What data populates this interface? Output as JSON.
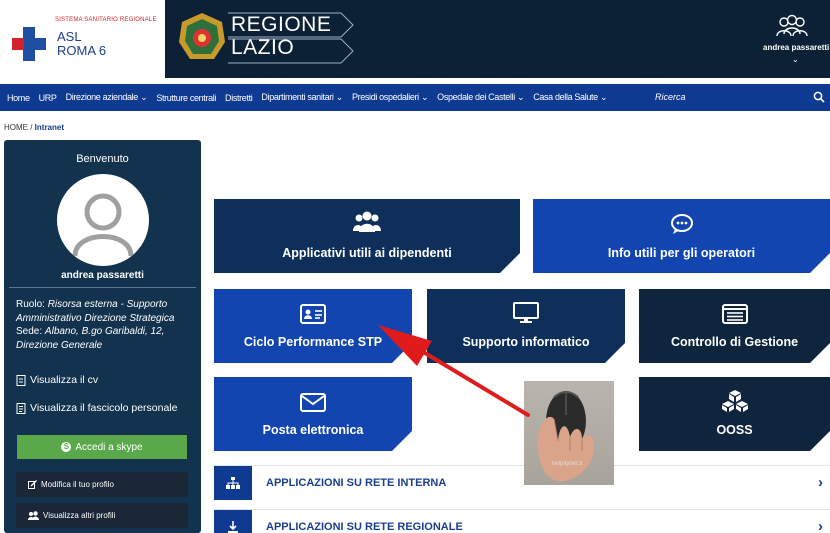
{
  "header": {
    "asl_supertitle": "SISTEMA SANITARIO REGIONALE",
    "asl_line1": "ASL",
    "asl_line2": "ROMA 6",
    "region_line1": "REGIONE",
    "region_line2": "LAZIO",
    "user_name": "andrea passaretti",
    "user_chevron": "⌄"
  },
  "nav": {
    "items": [
      "Home",
      "URP",
      "Direzione aziendale ⌄",
      "Strutture centrali",
      "Distretti",
      "Dipartimenti sanitari ⌄",
      "Presidi ospedalieri ⌄",
      "Ospedale dei Castelli ⌄",
      "Casa della Salute ⌄"
    ],
    "search_placeholder": "Ricerca"
  },
  "breadcrumb": {
    "home": "HOME",
    "sep": " / ",
    "current": "Intranet"
  },
  "sidebar": {
    "welcome": "Benvenuto",
    "name": "andrea passaretti",
    "role_label": "Ruolo: ",
    "role_value": "Risorsa esterna - Supporto Amministrativo Direzione Strategica",
    "seat_label": "Sede: ",
    "seat_value": "Albano, B.go Garibaldi, 12, Direzione Generale",
    "cv_link": "Visualizza il cv",
    "fascicolo_link": "Visualizza il fascicolo personale",
    "skype_button": "Accedi a skype",
    "edit_profile": "Modifica il tuo profilo",
    "other_profiles": "Visualizza altri profili"
  },
  "tiles": {
    "applicativi": "Applicativi utili ai dipendenti",
    "info": "Info utili per gli operatori",
    "ciclo": "Ciclo Performance STP",
    "supporto": "Supporto informatico",
    "controllo": "Controllo di Gestione",
    "posta": "Posta elettronica",
    "ooss": "OOSS"
  },
  "rows": {
    "interna": "APPLICAZIONI SU RETE INTERNA",
    "regionale": "APPLICAZIONI SU RETE REGIONALE",
    "chevron": "›"
  },
  "watermark": "helpitynet.it",
  "colors": {
    "nav_blue": "#0f3a92",
    "tile_bright": "#1245b0",
    "tile_dark": "#0f253d",
    "sidebar": "#13324d",
    "skype_green": "#5aa84a",
    "arrow_red": "#e01b1b"
  }
}
